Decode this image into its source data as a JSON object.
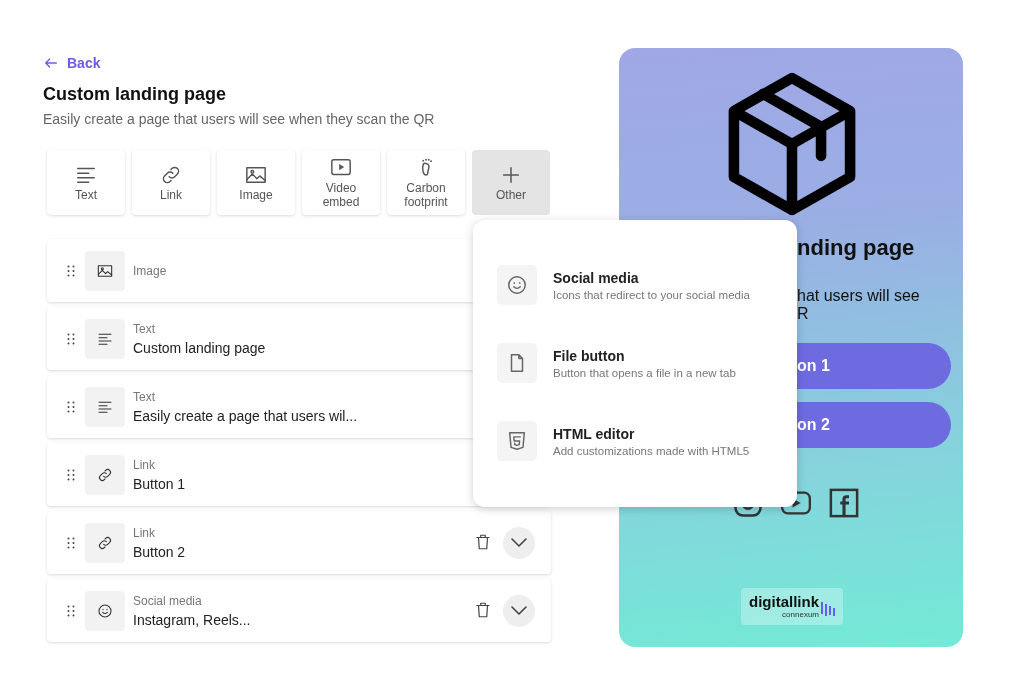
{
  "back": {
    "label": "Back"
  },
  "title": "Custom landing page",
  "subtitle": "Easily create a page that users will see when they scan the QR",
  "tools": [
    {
      "label": "Text",
      "kind": "text",
      "selected": false
    },
    {
      "label": "Link",
      "kind": "link",
      "selected": false
    },
    {
      "label": "Image",
      "kind": "image",
      "selected": false
    },
    {
      "label": "Video embed",
      "kind": "video",
      "selected": false
    },
    {
      "label": "Carbon footprint",
      "kind": "footprint",
      "selected": false
    },
    {
      "label": "Other",
      "kind": "other",
      "selected": true
    }
  ],
  "blocks": [
    {
      "type": "Image",
      "kind": "image"
    },
    {
      "type": "Text",
      "kind": "text",
      "value": "Custom landing page"
    },
    {
      "type": "Text",
      "kind": "text",
      "value": "Easily create a page that users wil..."
    },
    {
      "type": "Link",
      "kind": "link",
      "value": "Button 1"
    },
    {
      "type": "Link",
      "kind": "link",
      "value": "Button 2",
      "actions": true
    },
    {
      "type": "Social media",
      "kind": "social",
      "value": "Instagram, Reels...",
      "actions": true
    }
  ],
  "menu": {
    "items": [
      {
        "title": "Social media",
        "description": "Icons that redirect to your social media",
        "kind": "social"
      },
      {
        "title": "File button",
        "description": "Button that opens a file in a new tab",
        "kind": "file"
      },
      {
        "title": "HTML editor",
        "description": "Add customizations made with HTML5",
        "kind": "html"
      }
    ]
  },
  "preview": {
    "title": "nding page",
    "text_lines": [
      "hat users will see",
      "R"
    ],
    "buttons": [
      "on 1",
      "on 2"
    ],
    "logo": {
      "name": "digitallink",
      "tagline": "connexum"
    }
  }
}
